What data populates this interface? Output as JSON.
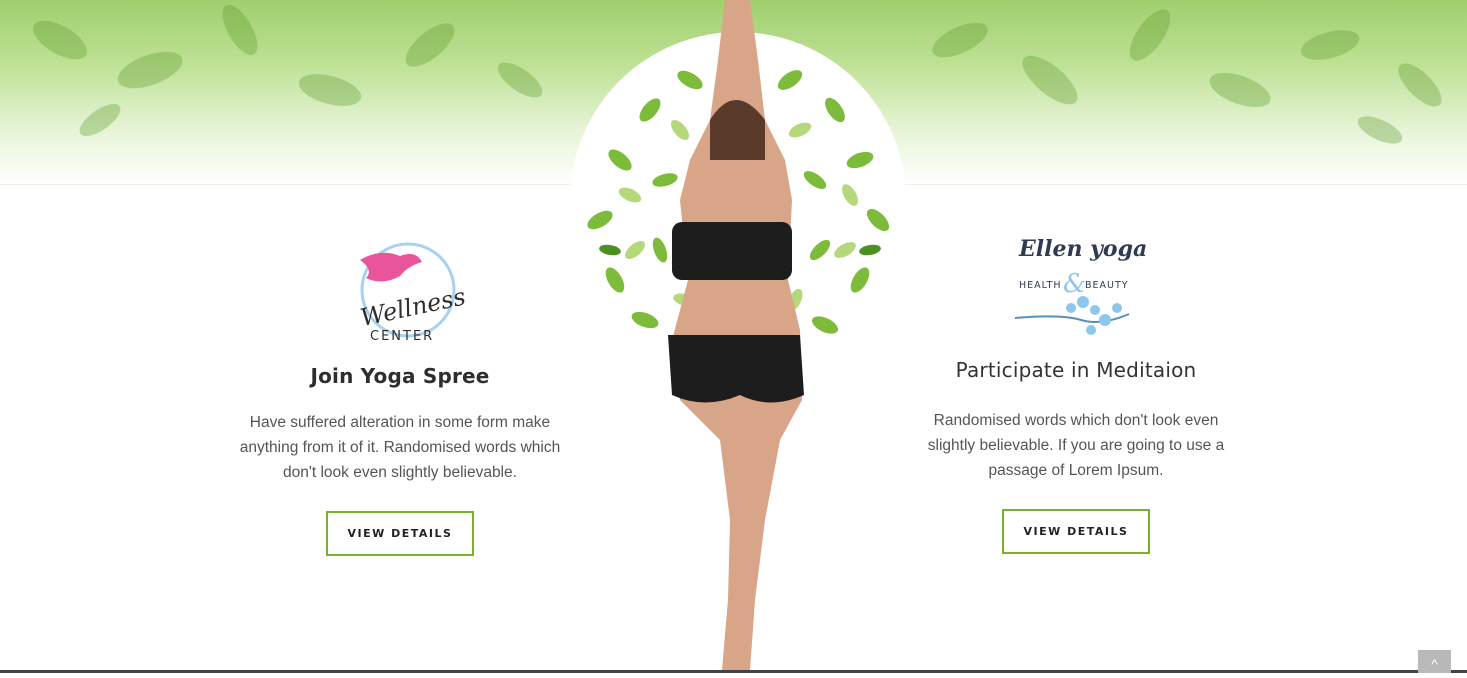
{
  "left_card": {
    "logo_text": "Wellness",
    "logo_subtext": "CENTER",
    "title": "Join Yoga Spree",
    "description": "Have suffered alteration in some form make anything from it of it. Randomised words which don't look even slightly believable.",
    "button_label": "VIEW DETAILS"
  },
  "right_card": {
    "logo_text": "Ellen yoga",
    "logo_subtext_left": "HEALTH",
    "logo_ampersand": "&",
    "logo_subtext_right": "BEAUTY",
    "title": "Participate in Meditaion",
    "description": "Randomised words which don't look even slightly believable. If you are going to use a passage of Lorem Ipsum.",
    "button_label": "VIEW DETAILS"
  },
  "scroll_top": {
    "icon": "chevron-up-icon",
    "glyph": "^"
  },
  "colors": {
    "accent_green": "#79b12d",
    "leaf_green": "#7dbb3a",
    "pink": "#e8559a",
    "navy": "#2f3b55",
    "sky_blue": "#8fc7ec"
  }
}
